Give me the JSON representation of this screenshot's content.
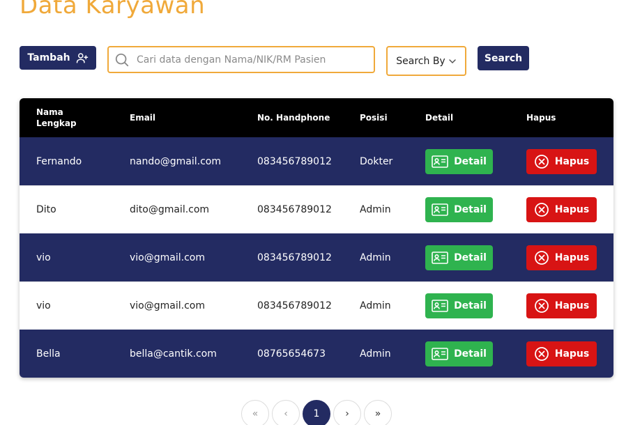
{
  "page": {
    "title": "Data Karyawan"
  },
  "toolbar": {
    "add_label": "Tambah",
    "search_placeholder": "Cari data dengan Nama/NIK/RM Pasien",
    "search_by_label": "Search By",
    "search_button_label": "Search"
  },
  "table": {
    "headers": {
      "name_line1": "Nama",
      "name_line2": "Lengkap",
      "email": "Email",
      "phone": "No. Handphone",
      "position": "Posisi",
      "detail": "Detail",
      "delete": "Hapus"
    },
    "rows": [
      {
        "name": "Fernando",
        "email": "nando@gmail.com",
        "phone": "083456789012",
        "position": "Dokter",
        "detail_label": "Detail",
        "delete_label": "Hapus"
      },
      {
        "name": "Dito",
        "email": "dito@gmail.com",
        "phone": "083456789012",
        "position": "Admin",
        "detail_label": "Detail",
        "delete_label": "Hapus"
      },
      {
        "name": "vio",
        "email": "vio@gmail.com",
        "phone": "083456789012",
        "position": "Admin",
        "detail_label": "Detail",
        "delete_label": "Hapus"
      },
      {
        "name": "vio",
        "email": "vio@gmail.com",
        "phone": "083456789012",
        "position": "Admin",
        "detail_label": "Detail",
        "delete_label": "Hapus"
      },
      {
        "name": "Bella",
        "email": "bella@cantik.com",
        "phone": "08765654673",
        "position": "Admin",
        "detail_label": "Detail",
        "delete_label": "Hapus"
      }
    ]
  },
  "pagination": {
    "first": "«",
    "prev": "‹",
    "current_page": "1",
    "next": "›",
    "last": "»"
  },
  "colors": {
    "accent_orange": "#f0a93a",
    "navy": "#232b62",
    "detail_green": "#2fb34f",
    "delete_red": "#d81414"
  }
}
